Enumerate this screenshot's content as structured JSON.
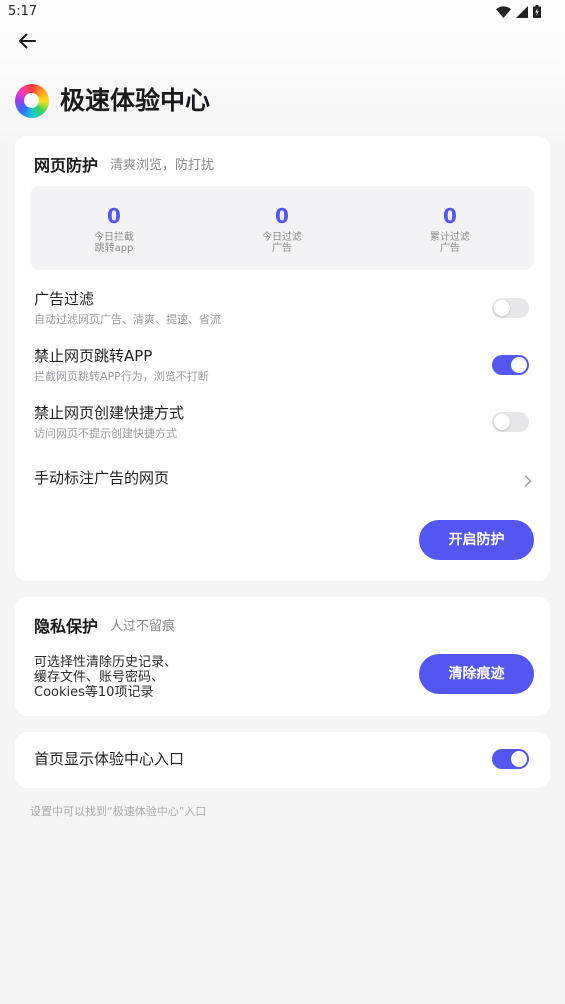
{
  "status_bar": {
    "time": "5:17",
    "icons": [
      "wifi-icon",
      "signal-icon",
      "battery-charging-icon"
    ]
  },
  "header": {
    "back_icon": "back-arrow-icon",
    "logo_icon": "color-ring-logo-icon",
    "title": "极速体验中心"
  },
  "web_protection": {
    "title": "网页防护",
    "subtitle": "清爽浏览，防打扰",
    "stats": [
      {
        "value": "0",
        "label_line1": "今日拦截",
        "label_line2": "跳转app"
      },
      {
        "value": "0",
        "label_line1": "今日过滤",
        "label_line2": "广告"
      },
      {
        "value": "0",
        "label_line1": "累计过滤",
        "label_line2": "广告"
      }
    ],
    "settings": [
      {
        "title": "广告过滤",
        "desc": "自动过滤网页广告、清爽、提速、省流",
        "enabled": false
      },
      {
        "title": "禁止网页跳转APP",
        "desc": "拦截网页跳转APP行为，浏览不打断",
        "enabled": true
      },
      {
        "title": "禁止网页创建快捷方式",
        "desc": "访问网页不提示创建快捷方式",
        "enabled": false
      }
    ],
    "manual_mark": {
      "label": "手动标注广告的网页",
      "icon": "chevron-right-icon"
    },
    "button_label": "开启防护"
  },
  "privacy": {
    "title": "隐私保护",
    "subtitle": "人过不留痕",
    "desc_lines": [
      "可选择性清除历史记录、",
      "缓存文件、账号密码、",
      "Cookies等10项记录"
    ],
    "button_label": "清除痕迹"
  },
  "homepage_entry": {
    "label": "首页显示体验中心入口",
    "enabled": true
  },
  "footer_note": "设置中可以找到“极速体验中心”入口",
  "colors": {
    "accent": "#5356f0",
    "toggle_off": "#e7e7e9",
    "card": "#ffffff",
    "subtext": "#9a9aa0"
  }
}
